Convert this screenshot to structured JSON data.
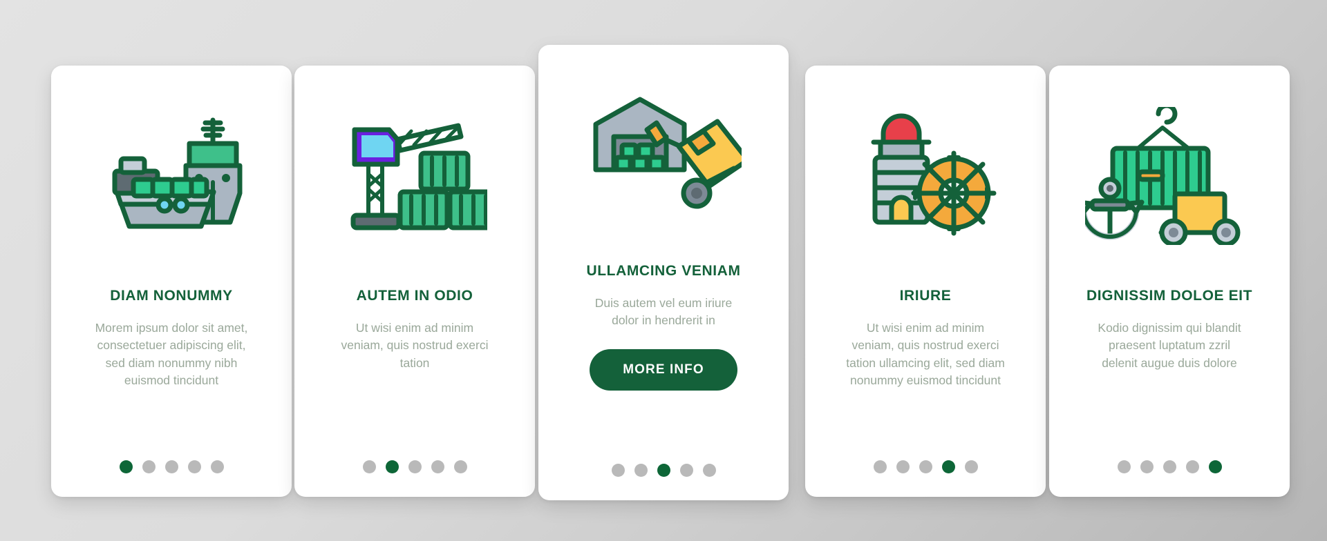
{
  "theme": {
    "page_background": "#dcdcdc",
    "card_background": "#ffffff",
    "brand_green": "#14613a",
    "accent_green": "#0d6637",
    "muted_text": "#9aa89a",
    "dot_inactive": "#b9b9b9"
  },
  "cards": [
    {
      "id": "card-1",
      "icon_name": "cargo-ship-icon",
      "title": "DIAM NONUMMY",
      "body": "Morem ipsum dolor sit amet, consectetuer adipiscing elit, sed diam nonummy nibh euismod tincidunt",
      "featured": false,
      "cta_label": null,
      "dots": {
        "count": 5,
        "active_index": 0
      }
    },
    {
      "id": "card-2",
      "icon_name": "port-crane-containers-icon",
      "title": "AUTEM IN ODIO",
      "body": "Ut wisi enim ad minim veniam, quis nostrud exerci tation",
      "featured": false,
      "cta_label": null,
      "dots": {
        "count": 5,
        "active_index": 1
      }
    },
    {
      "id": "card-3",
      "icon_name": "warehouse-hand-truck-icon",
      "title": "ULLAMCING VENIAM",
      "body": "Duis autem vel eum iriure dolor in hendrerit in",
      "featured": true,
      "cta_label": "MORE INFO",
      "dots": {
        "count": 5,
        "active_index": 2
      }
    },
    {
      "id": "card-4",
      "icon_name": "lighthouse-ship-wheel-icon",
      "title": "IRIURE",
      "body": "Ut wisi enim ad minim veniam, quis nostrud exerci tation ullamcing elit, sed diam nonummy euismod tincidunt",
      "featured": false,
      "cta_label": null,
      "dots": {
        "count": 5,
        "active_index": 3
      }
    },
    {
      "id": "card-5",
      "icon_name": "anchor-container-cargo-icon",
      "title": "DIGNISSIM DOLOE EIT",
      "body": "Kodio dignissim qui blandit praesent luptatum zzril delenit augue duis dolore",
      "featured": false,
      "cta_label": null,
      "dots": {
        "count": 5,
        "active_index": 4
      }
    }
  ]
}
